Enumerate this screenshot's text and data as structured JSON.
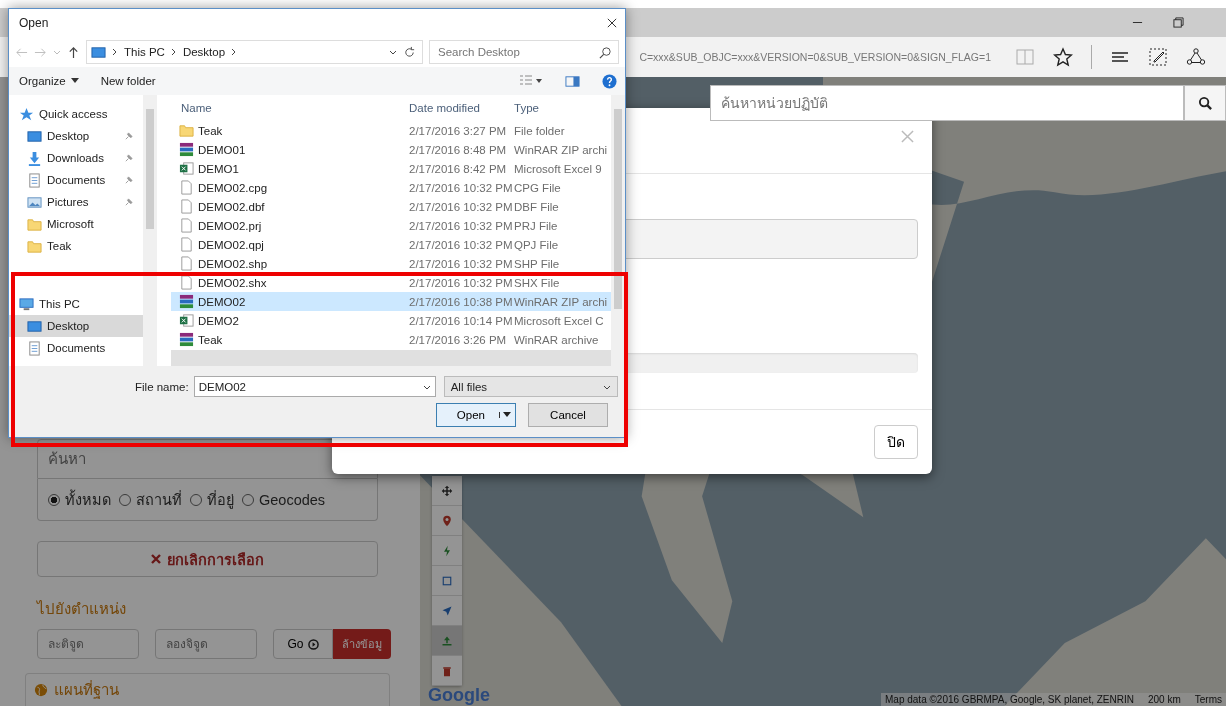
{
  "browser": {
    "address": "C=xxx&SUB_OBJC=xxx&VERSION=0&SUB_VERSION=0&SIGN_FLAG=1"
  },
  "left_panel": {
    "search": {
      "placeholder": "ค้นหา"
    },
    "search_types": [
      {
        "label": "ทั้งหมด",
        "selected": true
      },
      {
        "label": "สถานที่",
        "selected": false
      },
      {
        "label": "ที่อยู่",
        "selected": false
      },
      {
        "label": "Geocodes",
        "selected": false
      }
    ],
    "clear_selection_button": "ยกเลิกการเลือก",
    "goto_heading": "ไปยังตำแหน่ง",
    "latitude": {
      "placeholder": "ละติจูด"
    },
    "longitude": {
      "placeholder": "ลองจิจูด"
    },
    "go_button": "Go",
    "clear_button": "ล้างข้อมู",
    "basemap_heading": "แผนที่ฐาน"
  },
  "map": {
    "search": {
      "placeholder": "ค้นหาหน่วยปฏิบัติ"
    },
    "tools": [
      {
        "kind": "move",
        "selected": false
      },
      {
        "kind": "pin",
        "selected": false
      },
      {
        "kind": "bolt",
        "selected": false
      },
      {
        "kind": "square",
        "selected": false
      },
      {
        "kind": "arrow",
        "selected": false
      },
      {
        "kind": "upload",
        "selected": true
      },
      {
        "kind": "trash",
        "selected": false
      }
    ],
    "logo": "Google",
    "attribution": "Map data ©2016 GBRMPA, Google, SK planet, ZENRIN",
    "scale": "200 km",
    "terms": "Terms"
  },
  "modal": {
    "close_button": "ปิด"
  },
  "file_dialog": {
    "title": "Open",
    "breadcrumb": [
      "This PC",
      "Desktop"
    ],
    "search": {
      "placeholder": "Search Desktop"
    },
    "toolbar": [
      "Organize",
      "New folder"
    ],
    "nav": [
      {
        "label": "Quick access",
        "kind": "star",
        "selected": false,
        "children": [
          {
            "label": "Desktop",
            "kind": "desktop",
            "pinned": true,
            "selected": false
          },
          {
            "label": "Downloads",
            "kind": "download",
            "pinned": true,
            "selected": false
          },
          {
            "label": "Documents",
            "kind": "documents",
            "pinned": true,
            "selected": false
          },
          {
            "label": "Pictures",
            "kind": "pictures",
            "pinned": true,
            "selected": false
          },
          {
            "label": "Microsoft",
            "kind": "folder",
            "pinned": false,
            "selected": false
          },
          {
            "label": "Teak",
            "kind": "folder",
            "pinned": false,
            "selected": false
          }
        ]
      },
      {
        "label": "This PC",
        "kind": "pc",
        "selected": false,
        "children": [
          {
            "label": "Desktop",
            "kind": "desktop",
            "pinned": false,
            "selected": true
          },
          {
            "label": "Documents",
            "kind": "documents",
            "pinned": false,
            "selected": false
          }
        ]
      }
    ],
    "columns": [
      "Name",
      "Date modified",
      "Type"
    ],
    "files": [
      {
        "name": "Teak",
        "modified": "2/17/2016 3:27 PM",
        "type": "File folder",
        "kind": "folder",
        "selected": false
      },
      {
        "name": "DEMO01",
        "modified": "2/17/2016 8:48 PM",
        "type": "WinRAR ZIP archi",
        "kind": "rar",
        "selected": false
      },
      {
        "name": "DEMO1",
        "modified": "2/17/2016 8:42 PM",
        "type": "Microsoft Excel 9",
        "kind": "excel",
        "selected": false
      },
      {
        "name": "DEMO02.cpg",
        "modified": "2/17/2016 10:32 PM",
        "type": "CPG File",
        "kind": "file",
        "selected": false
      },
      {
        "name": "DEMO02.dbf",
        "modified": "2/17/2016 10:32 PM",
        "type": "DBF File",
        "kind": "file",
        "selected": false
      },
      {
        "name": "DEMO02.prj",
        "modified": "2/17/2016 10:32 PM",
        "type": "PRJ File",
        "kind": "file",
        "selected": false
      },
      {
        "name": "DEMO02.qpj",
        "modified": "2/17/2016 10:32 PM",
        "type": "QPJ File",
        "kind": "file",
        "selected": false
      },
      {
        "name": "DEMO02.shp",
        "modified": "2/17/2016 10:32 PM",
        "type": "SHP File",
        "kind": "file",
        "selected": false
      },
      {
        "name": "DEMO02.shx",
        "modified": "2/17/2016 10:32 PM",
        "type": "SHX File",
        "kind": "file",
        "selected": false
      },
      {
        "name": "DEMO02",
        "modified": "2/17/2016 10:38 PM",
        "type": "WinRAR ZIP archi",
        "kind": "rar",
        "selected": true
      },
      {
        "name": "DEMO2",
        "modified": "2/17/2016 10:14 PM",
        "type": "Microsoft Excel C",
        "kind": "excel",
        "selected": false
      },
      {
        "name": "Teak",
        "modified": "2/17/2016 3:26 PM",
        "type": "WinRAR archive",
        "kind": "rar",
        "selected": false
      }
    ],
    "file_name_label": "File name:",
    "file_name": "DEMO02",
    "filter": "All files",
    "open_button": "Open",
    "cancel_button": "Cancel"
  }
}
